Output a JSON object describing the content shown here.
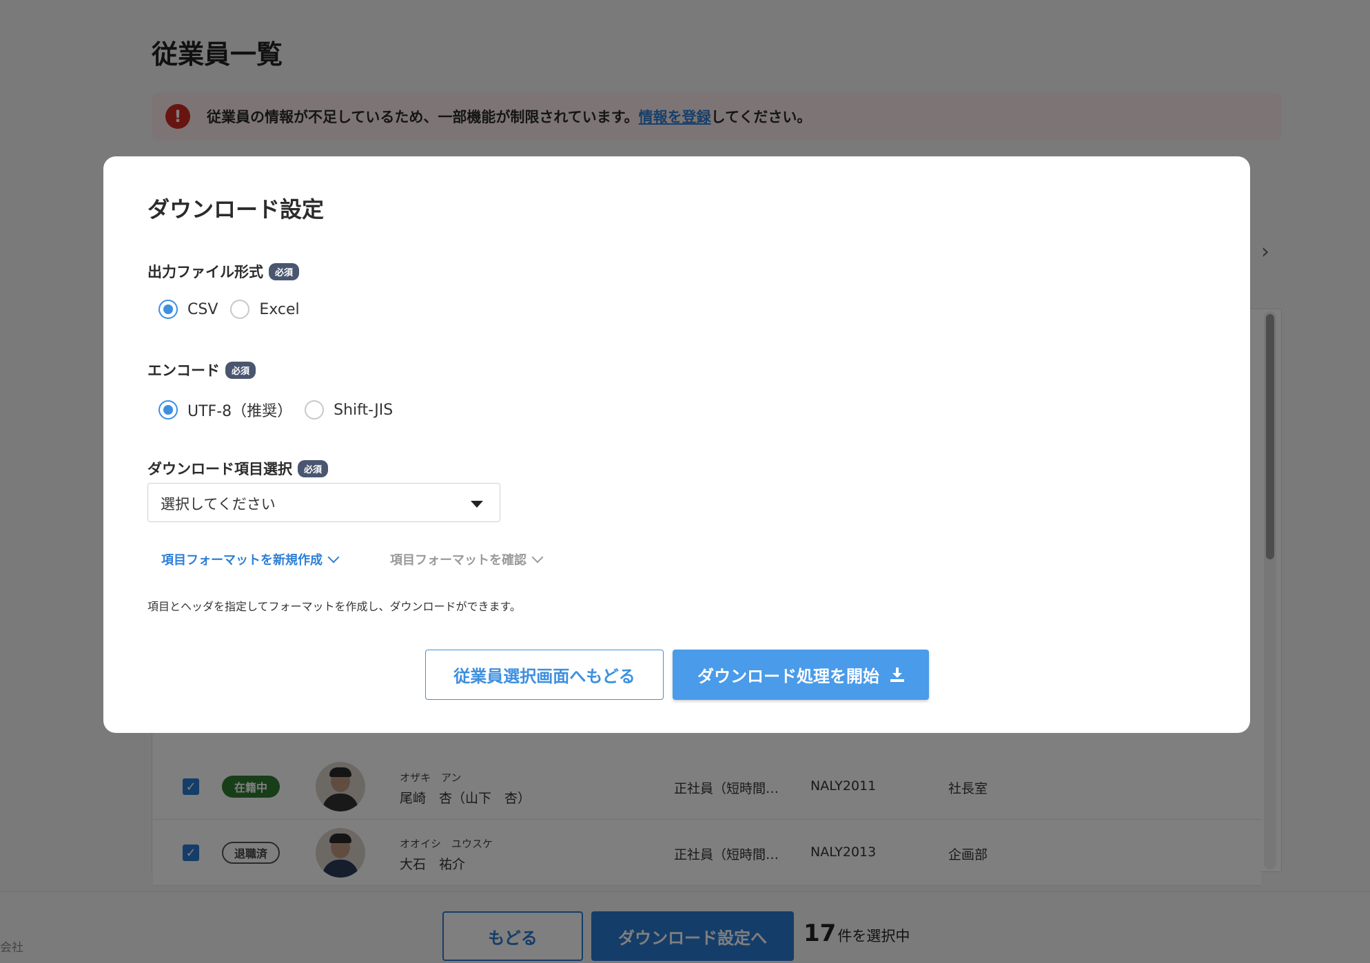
{
  "page": {
    "title": "従業員一覧",
    "alert": {
      "text_before": "従業員の情報が不足しているため、一部機能が制限されています。",
      "link": "情報を登録",
      "text_after": "してください。"
    },
    "rows": [
      {
        "status": "在籍中",
        "kana": "オザキ　アン",
        "name": "尾崎　杏（山下　杏）",
        "employment_type": "正社員（短時間…",
        "code": "NALY2011",
        "department": "社長室"
      },
      {
        "status": "退職済",
        "kana": "オオイシ　ユウスケ",
        "name": "大石　祐介",
        "employment_type": "正社員（短時間…",
        "code": "NALY2013",
        "department": "企画部"
      }
    ],
    "footer": {
      "company": "会社",
      "back_button": "もどる",
      "settings_button": "ダウンロード設定へ",
      "selected_count": "17",
      "selected_suffix": "件を選択中"
    }
  },
  "modal": {
    "title": "ダウンロード設定",
    "required_badge": "必須",
    "file_format": {
      "label": "出力ファイル形式",
      "options": [
        "CSV",
        "Excel"
      ],
      "selected": "CSV"
    },
    "encoding": {
      "label": "エンコード",
      "options": [
        "UTF-8（推奨）",
        "Shift-JIS"
      ],
      "selected": "UTF-8（推奨）"
    },
    "items": {
      "label": "ダウンロード項目選択",
      "placeholder": "選択してください"
    },
    "links": {
      "new_format": "項目フォーマットを新規作成",
      "confirm_format": "項目フォーマットを確認"
    },
    "help_text": "項目とヘッダを指定してフォーマットを作成し、ダウンロードができます。",
    "buttons": {
      "return": "従業員選択画面へもどる",
      "start": "ダウンロード処理を開始"
    }
  },
  "colors": {
    "accent": "#3d8fe0",
    "alert_red": "#d12b22",
    "active_badge": "#2e7d32",
    "required_badge": "#4a5670"
  }
}
